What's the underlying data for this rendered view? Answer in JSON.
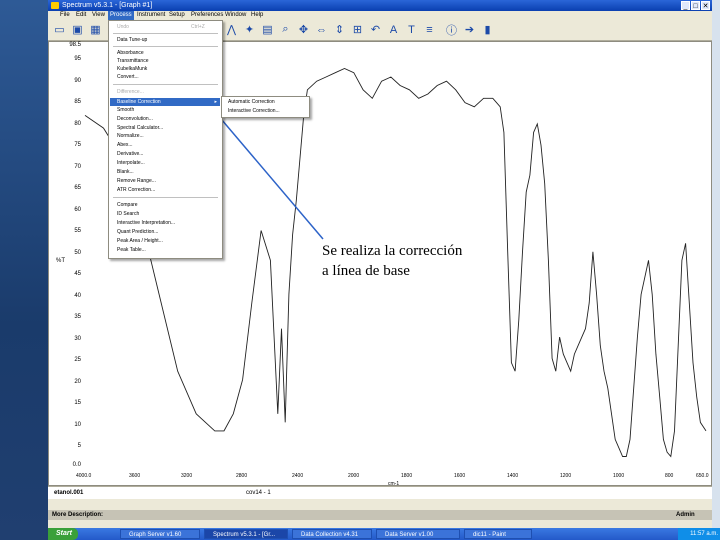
{
  "window": {
    "title": "Spectrum v5.3.1 - [Graph #1]",
    "controls": [
      "_",
      "□",
      "✕"
    ]
  },
  "menubar": {
    "items": [
      "File",
      "Edit",
      "View",
      "Process",
      "Instrument",
      "Setup",
      "Preferences",
      "Window",
      "Help"
    ]
  },
  "process_menu": {
    "items": [
      {
        "label": "Undo",
        "disabled": true,
        "shortcut": "Ctrl+Z"
      },
      {
        "label": "Data Tune-up",
        "disabled": false
      },
      {
        "label": "Absorbance",
        "disabled": false
      },
      {
        "label": "Transmittance",
        "disabled": false
      },
      {
        "label": "KubelkaMunk",
        "disabled": false
      },
      {
        "label": "Convert...",
        "disabled": false
      },
      {
        "label": "Difference...",
        "disabled": true
      },
      {
        "label": "Baseline Correction",
        "disabled": false,
        "highlighted": true
      },
      {
        "label": "Smooth",
        "disabled": false
      },
      {
        "label": "Deconvolution...",
        "disabled": false
      },
      {
        "label": "Spectral Calculator...",
        "disabled": false
      },
      {
        "label": "Normalize...",
        "disabled": false
      },
      {
        "label": "Abex...",
        "disabled": false
      },
      {
        "label": "Derivative...",
        "disabled": false
      },
      {
        "label": "Interpolate...",
        "disabled": false
      },
      {
        "label": "Blank...",
        "disabled": false
      },
      {
        "label": "Remove Range...",
        "disabled": false
      },
      {
        "label": "ATR Correction...",
        "disabled": false
      },
      {
        "label": "Compare",
        "disabled": false
      },
      {
        "label": "ID Search",
        "disabled": false
      },
      {
        "label": "Interactive Interpretation...",
        "disabled": false
      },
      {
        "label": "Quant Prediction...",
        "disabled": false
      },
      {
        "label": "Peak Area / Height...",
        "disabled": false
      },
      {
        "label": "Peak Table...",
        "disabled": false
      }
    ],
    "submenu": [
      "Automatic Correction",
      "Interactive Correction..."
    ]
  },
  "chart": {
    "ylabel": "%T",
    "xlabel": "cm-1",
    "yticks": [
      "98.5",
      "95",
      "90",
      "85",
      "80",
      "75",
      "70",
      "65",
      "60",
      "55",
      "50",
      "45",
      "40",
      "35",
      "30",
      "25",
      "20",
      "15",
      "10",
      "5",
      "0.0"
    ],
    "xticks": [
      "4000.0",
      "3600",
      "3200",
      "2800",
      "2400",
      "2000",
      "1800",
      "1600",
      "1400",
      "1200",
      "1000",
      "800",
      "650.0"
    ]
  },
  "chart_data": {
    "type": "line",
    "title": "",
    "xlabel": "cm-1",
    "ylabel": "%T",
    "xlim": [
      4000,
      650
    ],
    "ylim": [
      0,
      98.5
    ],
    "grid": false,
    "series": [
      {
        "x": [
          4000,
          3900,
          3800,
          3700,
          3600,
          3500,
          3400,
          3300,
          3250,
          3200,
          3150,
          3100,
          3050,
          3000,
          2980,
          2960,
          2940,
          2920,
          2900,
          2880,
          2860,
          2840,
          2820,
          2800,
          2750,
          2700,
          2650,
          2600,
          2550,
          2500,
          2450,
          2400,
          2350,
          2300,
          2250,
          2200,
          2150,
          2100,
          2050,
          2000,
          1950,
          1900,
          1850,
          1800,
          1780,
          1760,
          1740,
          1720,
          1700,
          1680,
          1660,
          1640,
          1620,
          1600,
          1580,
          1560,
          1540,
          1520,
          1500,
          1480,
          1460,
          1440,
          1420,
          1400,
          1380,
          1360,
          1340,
          1320,
          1300,
          1280,
          1260,
          1240,
          1220,
          1200,
          1180,
          1160,
          1140,
          1120,
          1100,
          1080,
          1060,
          1040,
          1020,
          1000,
          980,
          960,
          940,
          920,
          900,
          880,
          860,
          840,
          820,
          800,
          780,
          760,
          740,
          720,
          700,
          680,
          650
        ],
        "y": [
          82,
          79,
          72,
          58,
          40,
          22,
          12,
          8,
          8,
          12,
          20,
          38,
          55,
          48,
          30,
          12,
          32,
          10,
          40,
          54,
          62,
          72,
          82,
          88,
          90,
          91,
          92,
          93,
          92,
          88,
          86,
          90,
          91,
          89,
          88,
          86,
          87,
          89,
          90,
          88,
          85,
          84,
          86,
          86,
          85,
          84,
          78,
          50,
          24,
          22,
          34,
          50,
          64,
          68,
          78,
          80,
          75,
          66,
          48,
          25,
          22,
          30,
          26,
          24,
          22,
          26,
          28,
          30,
          32,
          38,
          50,
          40,
          28,
          22,
          18,
          12,
          6,
          4,
          2,
          2,
          6,
          18,
          30,
          40,
          44,
          48,
          40,
          26,
          16,
          6,
          3,
          2,
          8,
          28,
          48,
          52,
          38,
          24,
          16,
          10,
          8
        ]
      }
    ]
  },
  "status": {
    "filename": "etanol.001",
    "info": "cov14 - 1"
  },
  "description": {
    "label": "More Description:",
    "user": "Admin"
  },
  "annotation": {
    "text": "Se realiza la corrección a línea de base"
  },
  "taskbar": {
    "start": "Start",
    "buttons": [
      "Graph Server v1.60",
      "Spectrum v5.3.1 - [Gr...",
      "Data Collection v4.31",
      "Data Server v1.00",
      "dic11 - Paint"
    ],
    "clock": "11:57 a.m."
  },
  "colors": {
    "titlebar": "#0a3fb0",
    "selection": "#316ac5",
    "arrow": "#2d63c8",
    "taskbar": "#2359c9"
  }
}
